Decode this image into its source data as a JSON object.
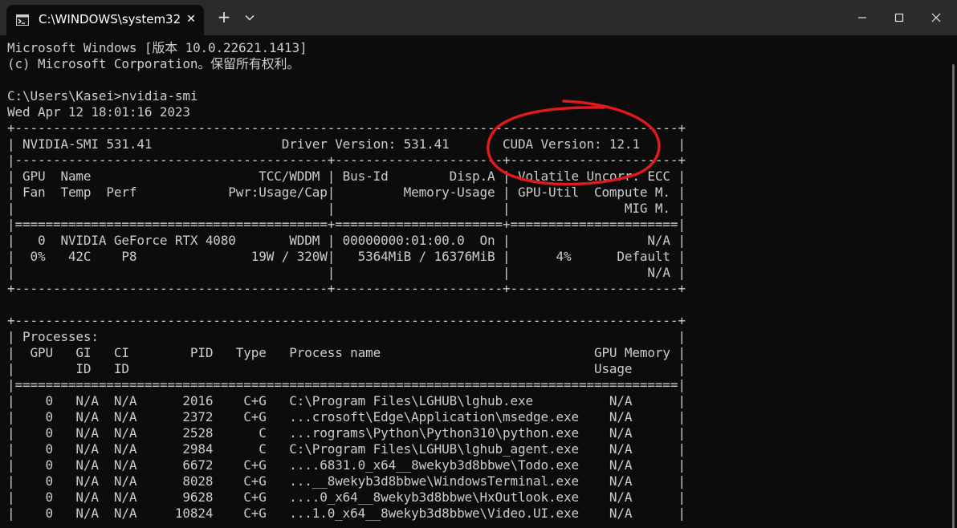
{
  "window": {
    "tab_title": "C:\\WINDOWS\\system32",
    "new_tab_label": "+",
    "close_tab_label": "✕"
  },
  "icons": {
    "tab": "terminal-icon",
    "close_tab": "close-icon",
    "new_tab": "plus-icon",
    "dropdown": "chevron-down-icon",
    "minimize": "minimize-icon",
    "maximize": "maximize-icon",
    "close_window": "close-icon"
  },
  "colors": {
    "background": "#0c0c0c",
    "titlebar": "#2b2b2b",
    "text": "#cccccc",
    "annotation": "#e0191c"
  },
  "terminal": {
    "lines": [
      "Microsoft Windows [版本 10.0.22621.1413]",
      "(c) Microsoft Corporation。保留所有权利。",
      "",
      "C:\\Users\\Kasei>nvidia-smi",
      "Wed Apr 12 18:01:16 2023",
      "+---------------------------------------------------------------------------------------+",
      "| NVIDIA-SMI 531.41                 Driver Version: 531.41       CUDA Version: 12.1     |",
      "|-----------------------------------------+----------------------+----------------------+",
      "| GPU  Name                      TCC/WDDM | Bus-Id        Disp.A | Volatile Uncorr. ECC |",
      "| Fan  Temp  Perf            Pwr:Usage/Cap|         Memory-Usage | GPU-Util  Compute M. |",
      "|                                         |                      |               MIG M. |",
      "|=========================================+======================+======================|",
      "|   0  NVIDIA GeForce RTX 4080       WDDM | 00000000:01:00.0  On |                  N/A |",
      "|  0%   42C    P8               19W / 320W|   5364MiB / 16376MiB |      4%      Default |",
      "|                                         |                      |                  N/A |",
      "+-----------------------------------------+----------------------+----------------------+",
      "",
      "+---------------------------------------------------------------------------------------+",
      "| Processes:                                                                            |",
      "|  GPU   GI   CI        PID   Type   Process name                            GPU Memory |",
      "|        ID   ID                                                             Usage      |",
      "|=======================================================================================|",
      "|    0   N/A  N/A      2016    C+G   C:\\Program Files\\LGHUB\\lghub.exe          N/A      |",
      "|    0   N/A  N/A      2372    C+G   ...crosoft\\Edge\\Application\\msedge.exe    N/A      |",
      "|    0   N/A  N/A      2528      C   ...rograms\\Python\\Python310\\python.exe    N/A      |",
      "|    0   N/A  N/A      2984      C   C:\\Program Files\\LGHUB\\lghub_agent.exe    N/A      |",
      "|    0   N/A  N/A      6672    C+G   ....6831.0_x64__8wekyb3d8bbwe\\Todo.exe    N/A      |",
      "|    0   N/A  N/A      8028    C+G   ...__8wekyb3d8bbwe\\WindowsTerminal.exe    N/A      |",
      "|    0   N/A  N/A      9628    C+G   ....0_x64__8wekyb3d8bbwe\\HxOutlook.exe    N/A      |",
      "|    0   N/A  N/A     10824    C+G   ...1.0_x64__8wekyb3d8bbwe\\Video.UI.exe    N/A      |"
    ]
  }
}
